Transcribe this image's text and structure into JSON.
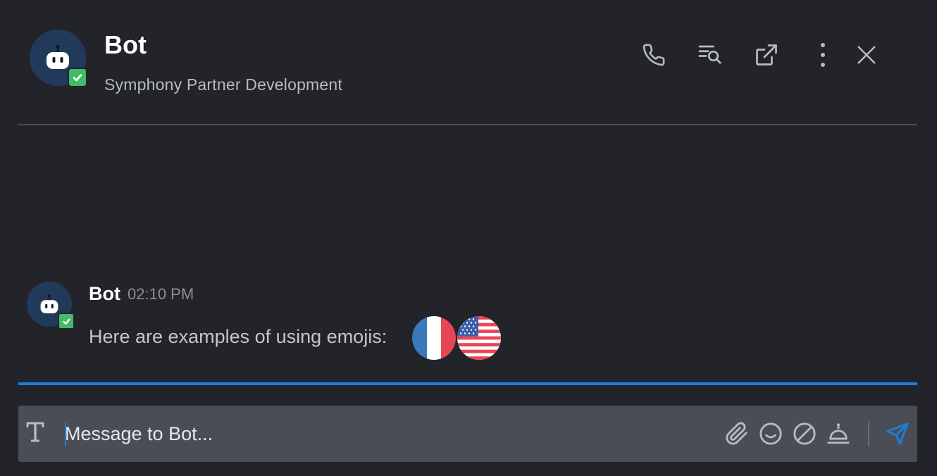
{
  "header": {
    "title": "Bot",
    "subtitle": "Symphony Partner Development",
    "actions": [
      {
        "name": "call",
        "icon": "phone-icon"
      },
      {
        "name": "search-conversation",
        "icon": "list-search-icon"
      },
      {
        "name": "pop-out",
        "icon": "external-link-icon"
      },
      {
        "name": "more",
        "icon": "more-vertical-icon"
      },
      {
        "name": "close",
        "icon": "close-icon"
      }
    ]
  },
  "message": {
    "author": "Bot",
    "time": "02:10 PM",
    "text": "Here are examples of using emojis:",
    "emojis": [
      "flag-france",
      "flag-united-states"
    ]
  },
  "composer": {
    "placeholder": "Message to Bot...",
    "value": "",
    "tools": [
      "format-text-icon",
      "attachment-icon",
      "emoji-icon",
      "block-icon",
      "bell-icon",
      "send-icon"
    ]
  },
  "colors": {
    "background": "#232429",
    "composer": "#4a4d56",
    "accent": "#1a7fe0",
    "verified": "#43b96a",
    "avatar": "#223a5a"
  }
}
